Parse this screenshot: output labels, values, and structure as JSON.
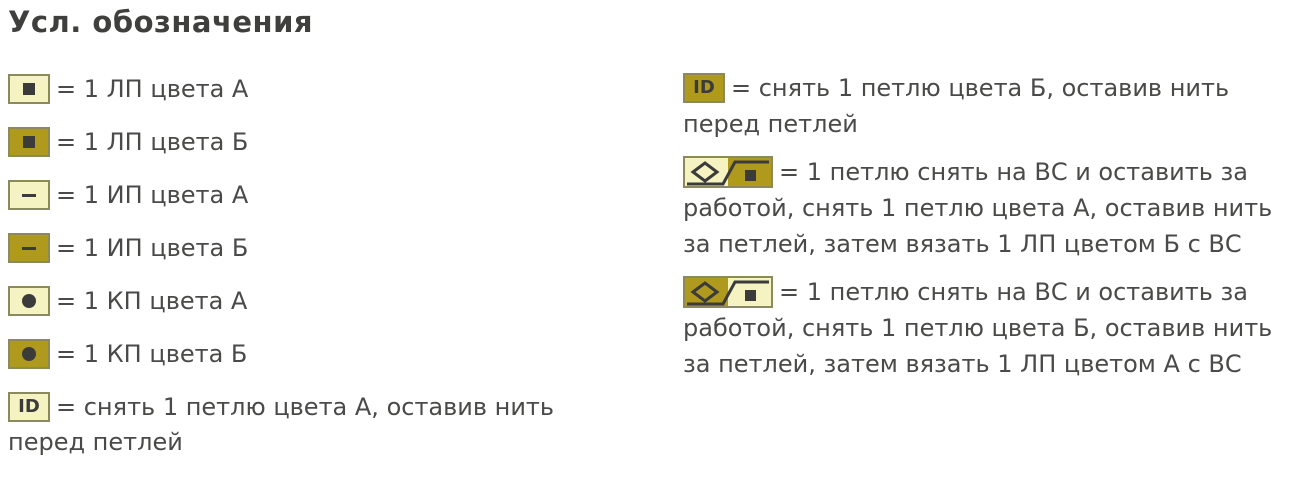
{
  "title": "Усл. обозначения",
  "colors": {
    "color_a_fill": "#f6f3c2",
    "color_b_fill": "#b09a1e",
    "cell_border": "#8a8a5c",
    "symbol_mark": "#3b3b3b",
    "text": "#4a4a48"
  },
  "left": [
    {
      "icon": "knit-square-icon",
      "color": "A",
      "text": "= 1 ЛП цвета А"
    },
    {
      "icon": "knit-square-icon",
      "color": "Б",
      "text": "= 1 ЛП цвета Б"
    },
    {
      "icon": "purl-dash-icon",
      "color": "A",
      "text": "= 1 ИП цвета А"
    },
    {
      "icon": "purl-dash-icon",
      "color": "Б",
      "text": "= 1 ИП  цвета Б"
    },
    {
      "icon": "crossed-dot-icon",
      "color": "A",
      "text": "= 1 КП цвета А"
    },
    {
      "icon": "crossed-dot-icon",
      "color": "Б",
      "text": "= 1 КП  цвета Б"
    },
    {
      "icon": "slip-id-icon",
      "color": "A",
      "symbol_text": "ID",
      "text": "= снять 1 петлю цвета А, оставив нить",
      "text2": "перед петлей"
    }
  ],
  "right": [
    {
      "icon": "slip-id-icon",
      "color": "Б",
      "symbol_text": "ID",
      "lines": [
        "= снять 1 петлю цвета Б, оставив нить",
        "перед петлей"
      ]
    },
    {
      "icon": "cable-cross-icon",
      "color": "A",
      "lines": [
        "= 1 петлю снять на ВС и оставить за",
        "работой, снять 1 петлю цвета А, оставив нить",
        "за петлей, затем вязать 1 ЛП цветом Б с ВС"
      ]
    },
    {
      "icon": "cable-cross-icon",
      "color": "Б",
      "lines": [
        "= 1 петлю снять на ВС и оставить за",
        "работой, снять 1 петлю цвета Б, оставив нить",
        "за петлей, затем вязать 1 ЛП цветом А с ВС"
      ]
    }
  ]
}
